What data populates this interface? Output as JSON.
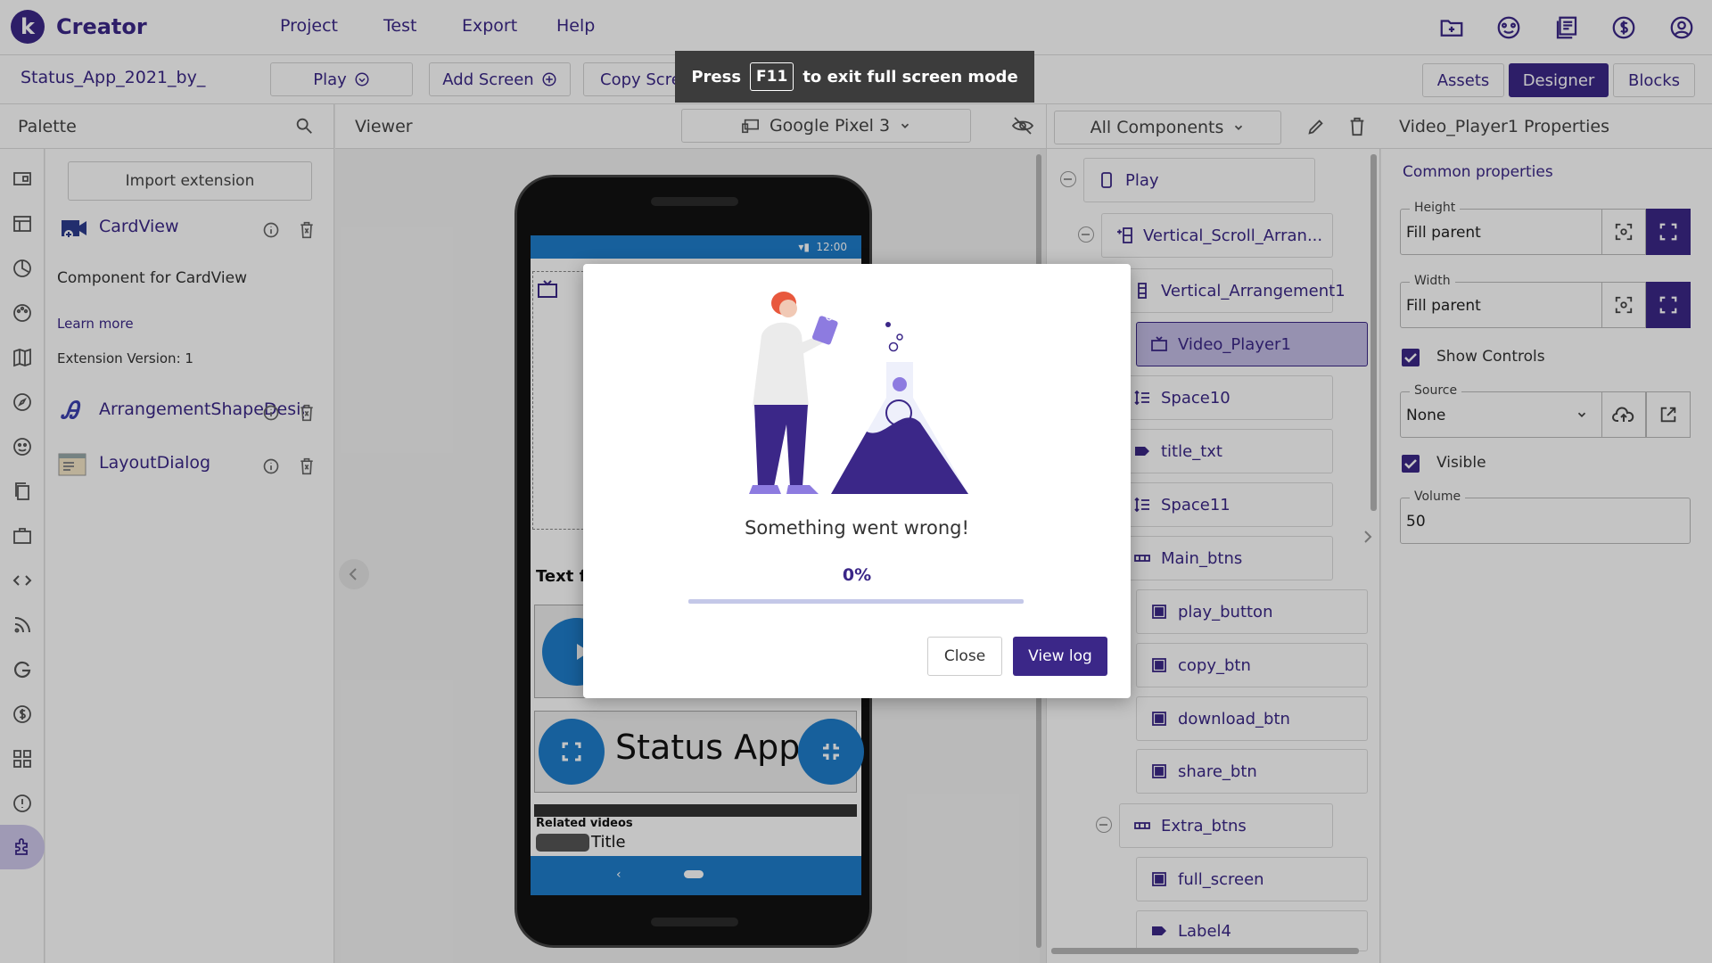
{
  "app": {
    "brand": "Creator",
    "logo_letter": "k"
  },
  "menu": {
    "items": [
      "Project",
      "Test",
      "Export",
      "Help"
    ]
  },
  "topbar_icons": [
    "folder-icon",
    "palette-icon",
    "book-icon",
    "dollar-icon",
    "account-icon"
  ],
  "toolbar": {
    "project_name": "Status_App_2021_by_",
    "play_label": "Play",
    "add_screen_label": "Add Screen",
    "copy_screen_label": "Copy Screen",
    "views": [
      "Assets",
      "Designer",
      "Blocks"
    ],
    "active_view": "Designer"
  },
  "toast": {
    "before": "Press",
    "key": "F11",
    "after": "to exit full screen mode"
  },
  "palette": {
    "title": "Palette",
    "import_label": "Import extension",
    "cardview_name": "CardView",
    "cardview_desc": "Component for CardView",
    "learn_more": "Learn more",
    "ext_version": "Extension Version: 1",
    "extensions": [
      "ArrangementShapeDesign",
      "LayoutDialog"
    ]
  },
  "viewer": {
    "title": "Viewer",
    "device": "Google Pixel 3",
    "status_time": "12:00",
    "text_label": "Text fo",
    "app_title": "Status App",
    "related": "Related videos",
    "video_title": "Title"
  },
  "components": {
    "filter": "All Components",
    "tree": [
      {
        "label": "Play",
        "icon": "phone-icon",
        "indent": 0,
        "collapse": true
      },
      {
        "label": "Vertical_Scroll_Arran...",
        "icon": "vscroll-icon",
        "indent": 1,
        "collapse": true
      },
      {
        "label": "Vertical_Arrangement1",
        "icon": "varrange-icon",
        "indent": 2
      },
      {
        "label": "Video_Player1",
        "icon": "video-icon",
        "indent": 2,
        "selected": true
      },
      {
        "label": "Space10",
        "icon": "space-icon",
        "indent": 1
      },
      {
        "label": "title_txt",
        "icon": "label-icon",
        "indent": 1
      },
      {
        "label": "Space11",
        "icon": "space-icon",
        "indent": 1
      },
      {
        "label": "Main_btns",
        "icon": "harrange-icon",
        "indent": 1,
        "collapse": true
      },
      {
        "label": "play_button",
        "icon": "button-icon",
        "indent": 2
      },
      {
        "label": "copy_btn",
        "icon": "button-icon",
        "indent": 2
      },
      {
        "label": "download_btn",
        "icon": "button-icon",
        "indent": 2
      },
      {
        "label": "share_btn",
        "icon": "button-icon",
        "indent": 2
      },
      {
        "label": "Extra_btns",
        "icon": "harrange-icon",
        "indent": 1,
        "collapse": true
      },
      {
        "label": "full_screen",
        "icon": "button-icon",
        "indent": 2
      },
      {
        "label": "Label4",
        "icon": "label-icon",
        "indent": 2
      }
    ]
  },
  "properties": {
    "title": "Video_Player1 Properties",
    "section": "Common properties",
    "height_label": "Height",
    "height_value": "Fill parent",
    "width_label": "Width",
    "width_value": "Fill parent",
    "show_controls_label": "Show Controls",
    "show_controls": true,
    "source_label": "Source",
    "source_value": "None",
    "visible_label": "Visible",
    "visible": true,
    "volume_label": "Volume",
    "volume_value": "50"
  },
  "modal": {
    "message": "Something went wrong!",
    "progress_text": "0%",
    "progress": 0,
    "close_label": "Close",
    "view_log_label": "View log"
  },
  "colors": {
    "accent": "#3b2788",
    "phone_blue": "#1f7dcc",
    "selected": "#c4bde6"
  }
}
